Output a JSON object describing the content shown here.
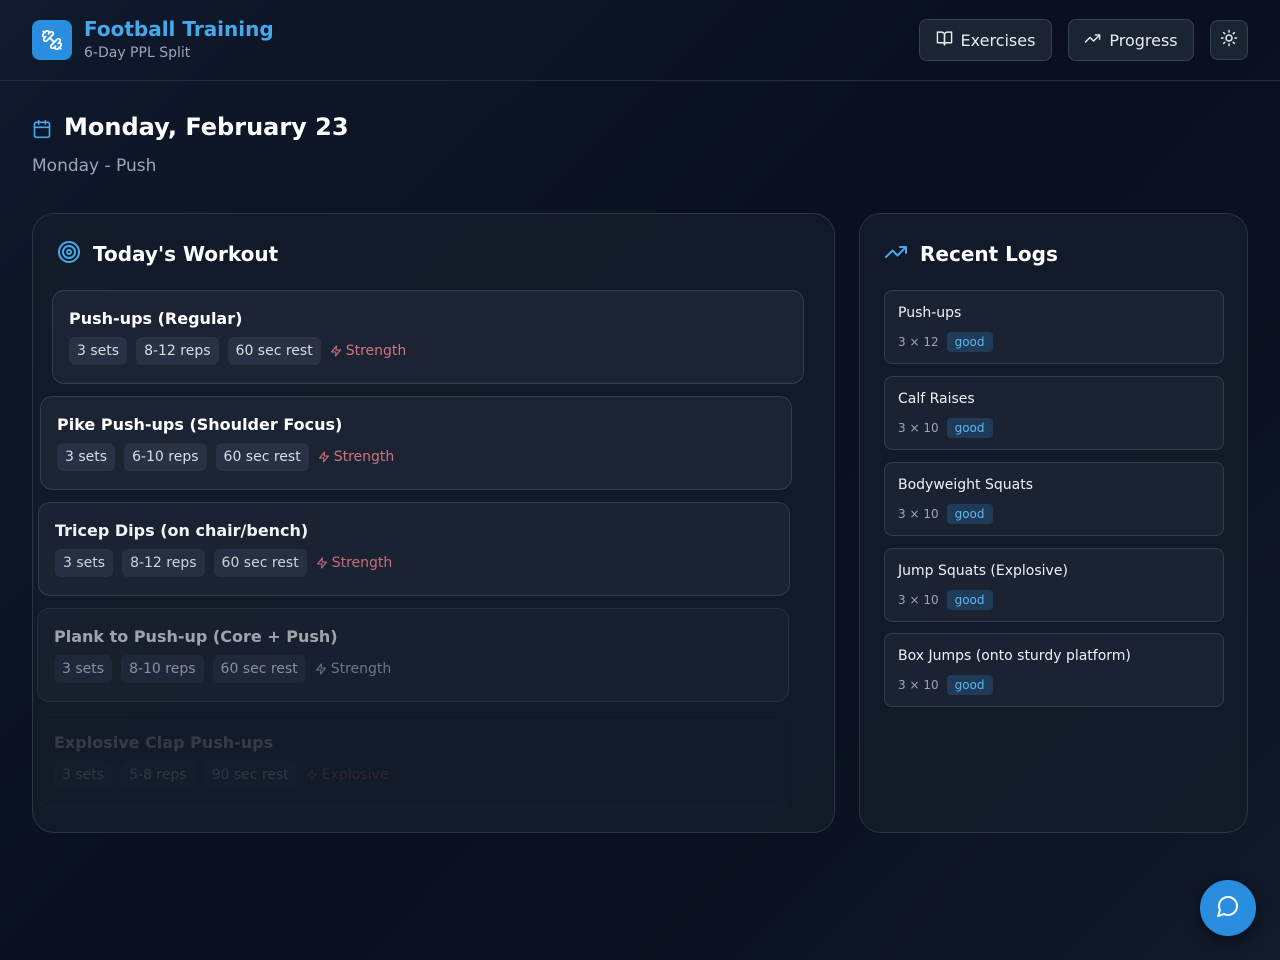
{
  "header": {
    "title": "Football Training",
    "subtitle": "6-Day PPL Split",
    "exercises_label": "Exercises",
    "progress_label": "Progress"
  },
  "date": {
    "title": "Monday, February 23",
    "subtitle": "Monday - Push"
  },
  "workout": {
    "title": "Today's Workout",
    "exercises": [
      {
        "name": "Push-ups (Regular)",
        "sets": "3 sets",
        "reps": "8-12 reps",
        "rest": "60 sec rest",
        "category": "Strength"
      },
      {
        "name": "Pike Push-ups (Shoulder Focus)",
        "sets": "3 sets",
        "reps": "6-10 reps",
        "rest": "60 sec rest",
        "category": "Strength"
      },
      {
        "name": "Tricep Dips (on chair/bench)",
        "sets": "3 sets",
        "reps": "8-12 reps",
        "rest": "60 sec rest",
        "category": "Strength"
      },
      {
        "name": "Plank to Push-up (Core + Push)",
        "sets": "3 sets",
        "reps": "8-10 reps",
        "rest": "60 sec rest",
        "category": "Strength"
      },
      {
        "name": "Explosive Clap Push-ups",
        "sets": "3 sets",
        "reps": "5-8 reps",
        "rest": "90 sec rest",
        "category": "Explosive"
      }
    ]
  },
  "logs": {
    "title": "Recent Logs",
    "items": [
      {
        "name": "Push-ups",
        "count": "3 × 12",
        "badge": "good"
      },
      {
        "name": "Calf Raises",
        "count": "3 × 10",
        "badge": "good"
      },
      {
        "name": "Bodyweight Squats",
        "count": "3 × 10",
        "badge": "good"
      },
      {
        "name": "Jump Squats (Explosive)",
        "count": "3 × 10",
        "badge": "good"
      },
      {
        "name": "Box Jumps (onto sturdy platform)",
        "count": "3 × 10",
        "badge": "good"
      }
    ]
  },
  "icons": {
    "logo": "dumbbell-icon",
    "exercises": "book-open-icon",
    "progress": "trending-up-icon",
    "theme": "sun-icon",
    "date": "calendar-icon",
    "workout": "target-icon",
    "logs": "trending-up-icon",
    "category": "zap-icon",
    "fab": "message-circle-icon"
  },
  "colors": {
    "accent": "#2a8ee0",
    "title": "#46a9ec",
    "category": "#d0737e",
    "badge_bg": "#1f3b58",
    "badge_text": "#5db4ee"
  }
}
